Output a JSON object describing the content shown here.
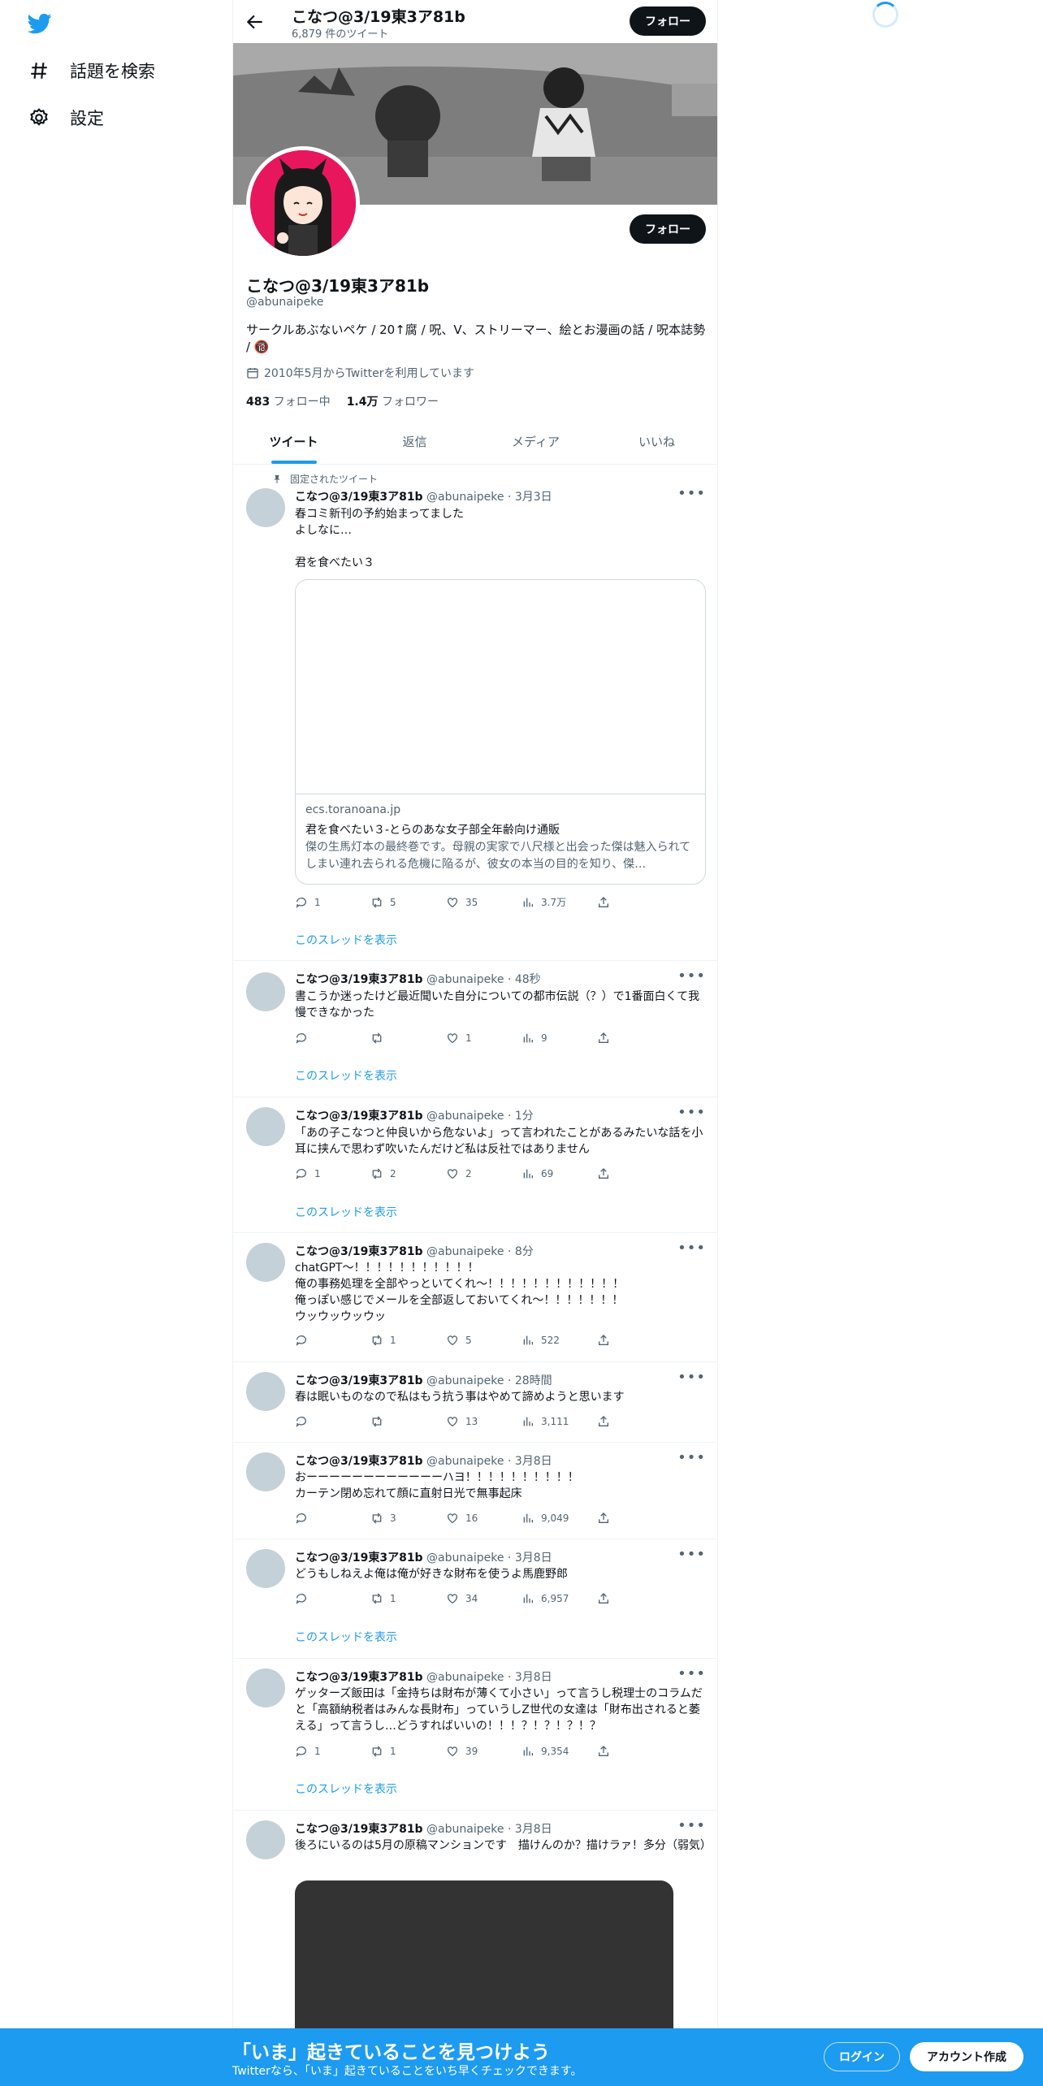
{
  "nav": {
    "explore_label": "話題を検索",
    "settings_label": "設定"
  },
  "header": {
    "name": "こなつ@3/19東3ア81b",
    "tweet_count": "6,879 件のツイート",
    "follow_label": "フォロー"
  },
  "profile": {
    "name": "こなつ@3/19東3ア81b",
    "handle": "@abunaipeke",
    "bio": "サークルあぶないペケ / 20↑腐 / 呪、V、ストリーマー、絵とお漫画の話 / 呪本誌勢 / 🔞",
    "joined": "2010年5月からTwitterを利用しています",
    "following_count": "483",
    "following_label": "フォロー中",
    "followers_count": "1.4万",
    "followers_label": "フォロワー",
    "follow_label": "フォロー"
  },
  "tabs": [
    "ツイート",
    "返信",
    "メディア",
    "いいね"
  ],
  "pinned_label": "固定されたツイート",
  "thread_link_label": "このスレッドを表示",
  "tweets": [
    {
      "name": "こなつ@3/19東3ア81b",
      "handle": "@abunaipeke",
      "time": "3月3日",
      "text": "春コミ新刊の予約始まってました\nよしなに…\n\n君を食べたい３",
      "reply": "1",
      "retweet": "5",
      "like": "35",
      "views": "3.7万",
      "card": {
        "domain": "ecs.toranoana.jp",
        "title": "君を食べたい３-とらのあな女子部全年齢向け通販",
        "description": "傑の生馬灯本の最終巻です。母親の実家で八尺様と出会った傑は魅入られてしまい連れ去られる危機に陥るが、彼女の本当の目的を知り、傑…"
      }
    },
    {
      "name": "こなつ@3/19東3ア81b",
      "handle": "@abunaipeke",
      "time": "48秒",
      "text": "書こうか迷ったけど最近聞いた自分についての都市伝説（？）で1番面白くて我慢できなかった",
      "reply": "",
      "retweet": "",
      "like": "1",
      "views": "9"
    },
    {
      "name": "こなつ@3/19東3ア81b",
      "handle": "@abunaipeke",
      "time": "1分",
      "text": "「あの子こなつと仲良いから危ないよ」って言われたことがあるみたいな話を小耳に挟んで思わず吹いたんだけど私は反社ではありません",
      "reply": "1",
      "retweet": "2",
      "like": "2",
      "views": "69"
    },
    {
      "name": "こなつ@3/19東3ア81b",
      "handle": "@abunaipeke",
      "time": "8分",
      "text": "chatGPT〜！！！！！！！！！！！\n俺の事務処理を全部やっといてくれ〜！！！！！！！！！！！！\n俺っぽい感じでメールを全部返しておいてくれ〜！！！！！！！\nウッウッウッウッ",
      "reply": "",
      "retweet": "1",
      "like": "5",
      "views": "522"
    },
    {
      "name": "こなつ@3/19東3ア81b",
      "handle": "@abunaipeke",
      "time": "28時間",
      "text": "春は眠いものなので私はもう抗う事はやめて諦めようと思います",
      "reply": "",
      "retweet": "",
      "like": "13",
      "views": "3,111"
    },
    {
      "name": "こなつ@3/19東3ア81b",
      "handle": "@abunaipeke",
      "time": "3月8日",
      "text": "おーーーーーーーーーーーーハヨ！！！！！！！！！！\nカーテン閉め忘れて顔に直射日光で無事起床",
      "reply": "",
      "retweet": "3",
      "like": "16",
      "views": "9,049"
    },
    {
      "name": "こなつ@3/19東3ア81b",
      "handle": "@abunaipeke",
      "time": "3月8日",
      "text": "どうもしねえよ俺は俺が好きな財布を使うよ馬鹿野郎",
      "reply": "",
      "retweet": "1",
      "like": "34",
      "views": "6,957"
    },
    {
      "name": "こなつ@3/19東3ア81b",
      "handle": "@abunaipeke",
      "time": "3月8日",
      "text": "ゲッターズ飯田は「金持ちは財布が薄くて小さい」って言うし税理士のコラムだと「高額納税者はみんな長財布」っていうしZ世代の女達は「財布出されると萎える」って言うし…どうすればいいの！！！？！？！？！？",
      "reply": "1",
      "retweet": "1",
      "like": "39",
      "views": "9,354"
    },
    {
      "name": "こなつ@3/19東3ア81b",
      "handle": "@abunaipeke",
      "time": "3月8日",
      "text": "後ろにいるのは5月の原稿マンションです　描けんのか？描けラァ！多分（弱気）"
    }
  ],
  "bottom_bar": {
    "title": "「いま」起きていることを見つけよう",
    "subtitle": "Twitterなら、「いま」起きていることをいち早くチェックできます。",
    "login_label": "ログイン",
    "signup_label": "アカウント作成"
  }
}
